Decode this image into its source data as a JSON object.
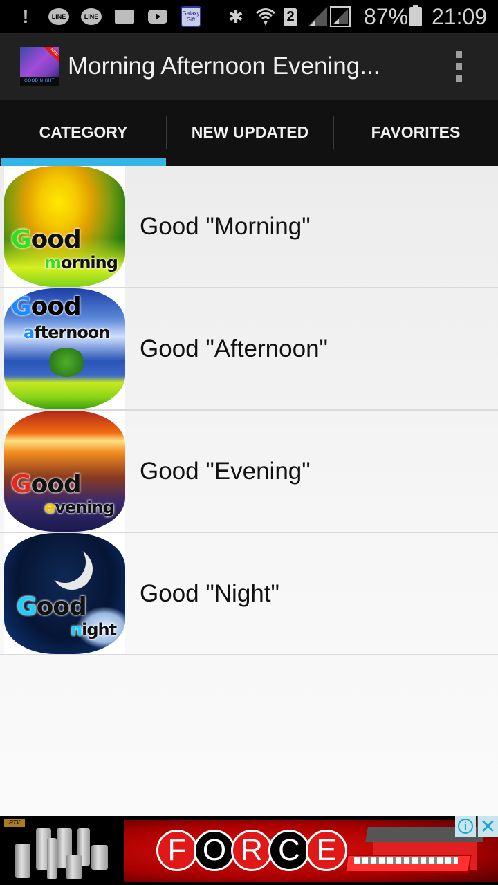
{
  "status_bar": {
    "notification_icons": [
      "alert-broom-icon",
      "line-icon",
      "line-icon",
      "folder-icon",
      "youtube-icon",
      "galaxy-gift-icon"
    ],
    "line_label": "LINE",
    "gift_label_top": "Galaxy",
    "gift_label_bottom": "Gift",
    "sim_number": "2",
    "battery_percent": "87%",
    "time": "21:09"
  },
  "action_bar": {
    "app_icon_badge": "NEW",
    "app_icon_caption": "GOOD NIGHT",
    "title": "Morning Afternoon Evening...",
    "overflow_menu": "more-options"
  },
  "tabs": {
    "items": [
      {
        "label": "CATEGORY",
        "selected": true
      },
      {
        "label": "NEW UPDATED",
        "selected": false
      },
      {
        "label": "FAVORITES",
        "selected": false
      }
    ],
    "indicator_color": "#33b5e5"
  },
  "categories": [
    {
      "label": "Good \"Morning\"",
      "thumb_line1_first": "G",
      "thumb_line1_rest": "ood",
      "thumb_line2_first": "m",
      "thumb_line2_rest": "orning"
    },
    {
      "label": "Good \"Afternoon\"",
      "thumb_line1_first": "G",
      "thumb_line1_rest": "ood",
      "thumb_line2_first": "a",
      "thumb_line2_rest": "fternoon"
    },
    {
      "label": "Good \"Evening\"",
      "thumb_line1_first": "G",
      "thumb_line1_rest": "ood",
      "thumb_line2_first": "e",
      "thumb_line2_rest": "vening"
    },
    {
      "label": "Good \"Night\"",
      "thumb_line1_first": "G",
      "thumb_line1_rest": "ood",
      "thumb_line2_first": "n",
      "thumb_line2_rest": "ight"
    }
  ],
  "ad": {
    "brand_logo": "RTV",
    "headline_letters": [
      "F",
      "O",
      "R",
      "C",
      "E"
    ],
    "info_icon": "i",
    "close_icon": "✕"
  }
}
